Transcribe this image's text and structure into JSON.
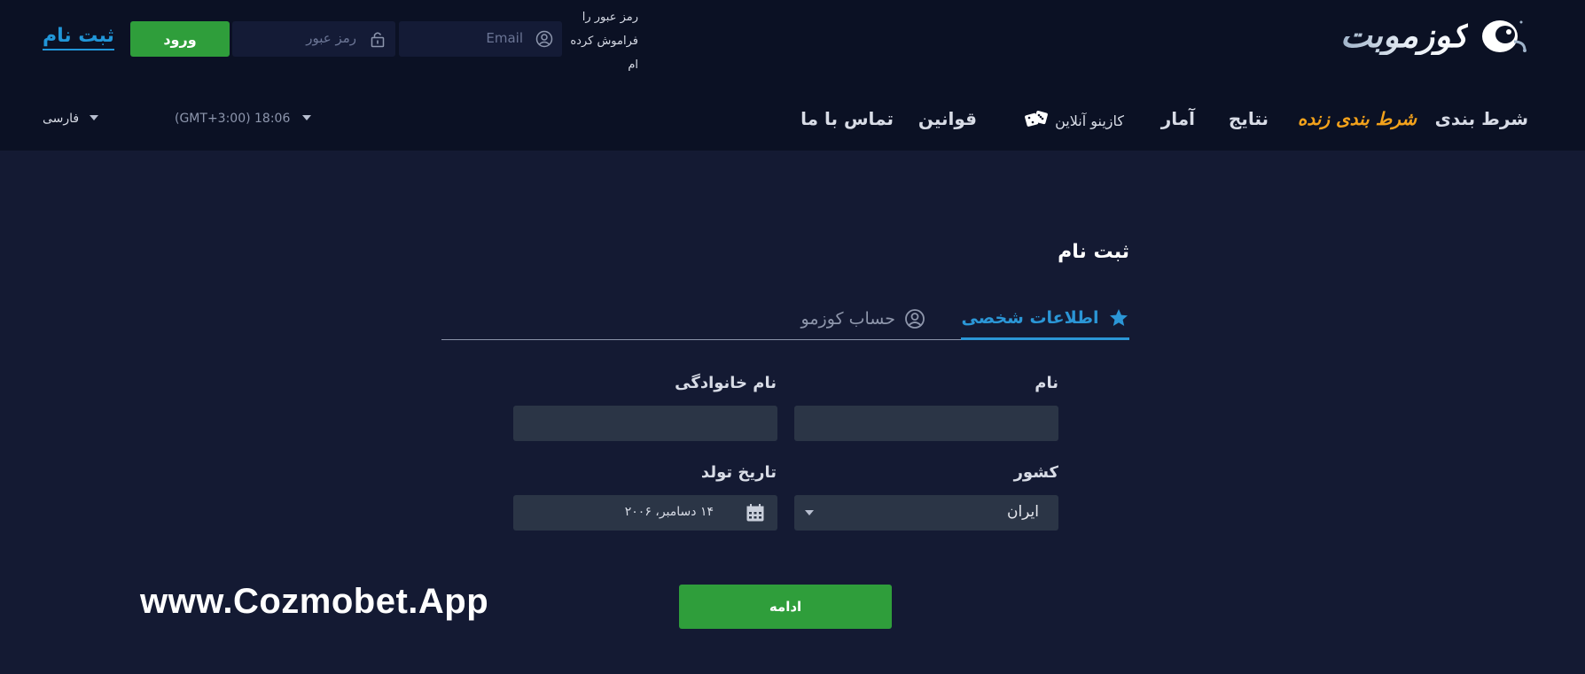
{
  "header": {
    "logo_text": "کوزموبت",
    "signup_link": "ثبت نام",
    "login_button": "ورود",
    "password_placeholder": "رمز عبور",
    "email_placeholder": "Email",
    "forgot_password": "رمز عبور را فراموش کرده ام"
  },
  "nav": {
    "items": [
      "شرط بندی",
      "شرط بندی زنده",
      "نتایج",
      "آمار",
      "کازینو آنلاین",
      "قوانین",
      "تماس با ما"
    ],
    "time": "(GMT+3:00) 18:06",
    "language": "فارسی"
  },
  "form": {
    "title": "ثبت نام",
    "tabs": [
      {
        "label": "اطلاعات شخصی",
        "icon": "star-icon",
        "active": true
      },
      {
        "label": "حساب کوزمو",
        "icon": "user-circle-icon",
        "active": false
      }
    ],
    "first_name_label": "نام",
    "first_name_value": "",
    "last_name_label": "نام خانوادگی",
    "last_name_value": "",
    "country_label": "کشور",
    "country_value": "ایران",
    "birthdate_label": "تاریخ تولد",
    "birthdate_value": "۱۴ دسامبر، ۲۰۰۶",
    "continue_button": "ادامه"
  },
  "watermark": "www.Cozmobet.App",
  "colors": {
    "background": "#141a33",
    "header_bg": "#0b1124",
    "accent_blue": "#2196d8",
    "green_button": "#2f9e3b",
    "live_orange": "#f3a21b",
    "input_bg": "#2b3546"
  }
}
